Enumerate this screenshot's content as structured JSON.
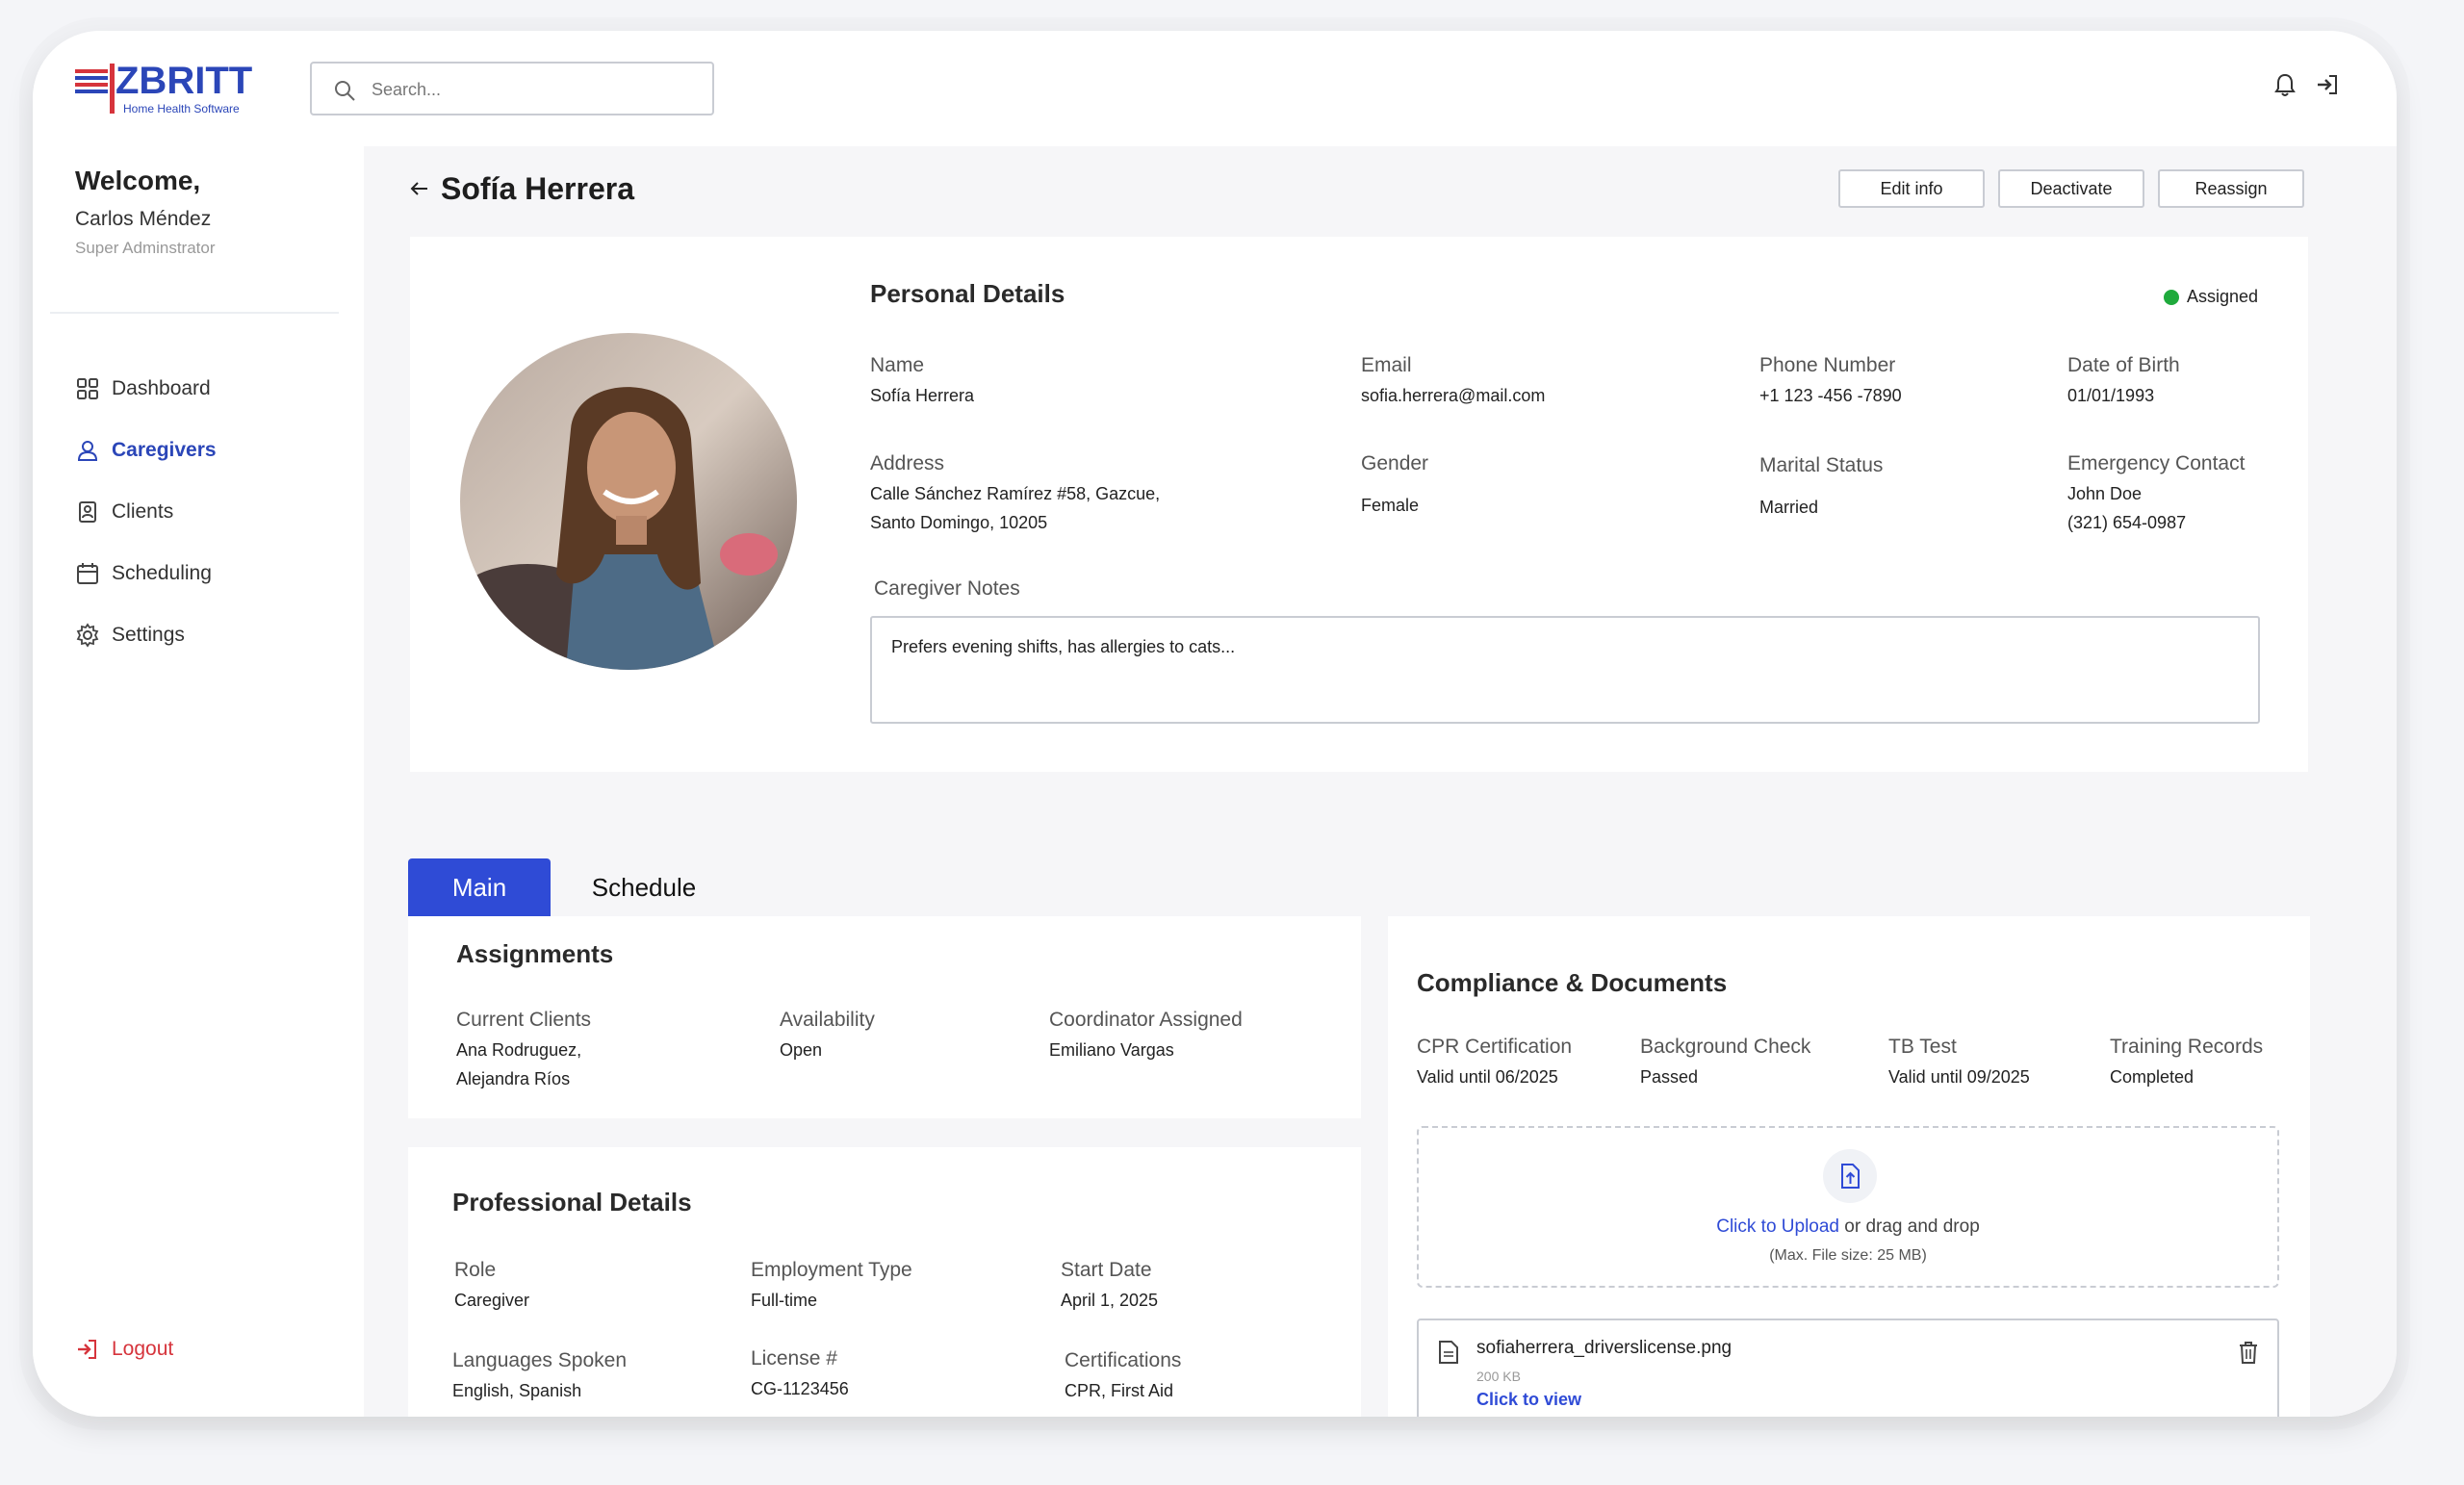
{
  "brand": {
    "name": "ZBRITT",
    "tagline": "Home Health Software"
  },
  "search": {
    "placeholder": "Search..."
  },
  "sidebar": {
    "welcome": "Welcome,",
    "user_name": "Carlos Méndez",
    "user_role": "Super Adminstrator",
    "items": [
      {
        "label": "Dashboard",
        "icon": "grid-icon"
      },
      {
        "label": "Caregivers",
        "icon": "person-icon",
        "active": true
      },
      {
        "label": "Clients",
        "icon": "id-badge-icon"
      },
      {
        "label": "Scheduling",
        "icon": "calendar-icon"
      },
      {
        "label": "Settings",
        "icon": "gear-icon"
      }
    ],
    "logout": "Logout"
  },
  "page": {
    "title": "Sofía Herrera",
    "actions": {
      "edit": "Edit info",
      "deactivate": "Deactivate",
      "reassign": "Reassign"
    }
  },
  "personal": {
    "title": "Personal Details",
    "status": "Assigned",
    "status_color": "#1faa3c",
    "name_label": "Name",
    "name": "Sofía Herrera",
    "email_label": "Email",
    "email": "sofia.herrera@mail.com",
    "phone_label": "Phone Number",
    "phone": "+1 123 -456 -7890",
    "dob_label": "Date of Birth",
    "dob": "01/01/1993",
    "address_label": "Address",
    "address_line1": "Calle Sánchez Ramírez #58, Gazcue,",
    "address_line2": "Santo Domingo, 10205",
    "gender_label": "Gender",
    "gender": "Female",
    "marital_label": "Marital Status",
    "marital": "Married",
    "emergency_label": "Emergency Contact",
    "emergency_name": "John Doe",
    "emergency_phone": "(321) 654-0987",
    "notes_label": "Caregiver Notes",
    "notes": "Prefers evening shifts, has allergies to cats..."
  },
  "tabs": [
    {
      "label": "Main",
      "active": true
    },
    {
      "label": "Schedule"
    }
  ],
  "assignments": {
    "title": "Assignments",
    "clients_label": "Current Clients",
    "client1": "Ana Rodruguez,",
    "client2": "Alejandra Ríos",
    "availability_label": "Availability",
    "availability": "Open",
    "coordinator_label": "Coordinator Assigned",
    "coordinator": "Emiliano Vargas"
  },
  "professional": {
    "title": "Professional Details",
    "role_label": "Role",
    "role": "Caregiver",
    "employment_label": "Employment Type",
    "employment": "Full-time",
    "start_label": "Start Date",
    "start": "April 1, 2025",
    "languages_label": "Languages Spoken",
    "languages": "English, Spanish",
    "license_label": "License #",
    "license": "CG-1123456",
    "certs_label": "Certifications",
    "certs": "CPR, First Aid"
  },
  "compliance": {
    "title": "Compliance & Documents",
    "cpr_label": "CPR Certification",
    "cpr": "Valid until 06/2025",
    "bg_label": "Background Check",
    "bg": "Passed",
    "tb_label": "TB Test",
    "tb": "Valid until 09/2025",
    "training_label": "Training Records",
    "training": "Completed",
    "upload_link": "Click to Upload",
    "upload_rest": " or drag and drop",
    "upload_hint": "(Max. File size: 25 MB)",
    "file_name": "sofiaherrera_driverslicense.png",
    "file_size": "200 KB",
    "file_view": "Click to view"
  },
  "colors": {
    "brand_blue": "#2b46b8",
    "brand_red": "#d6343c",
    "tab_active": "#2f4bd6"
  }
}
